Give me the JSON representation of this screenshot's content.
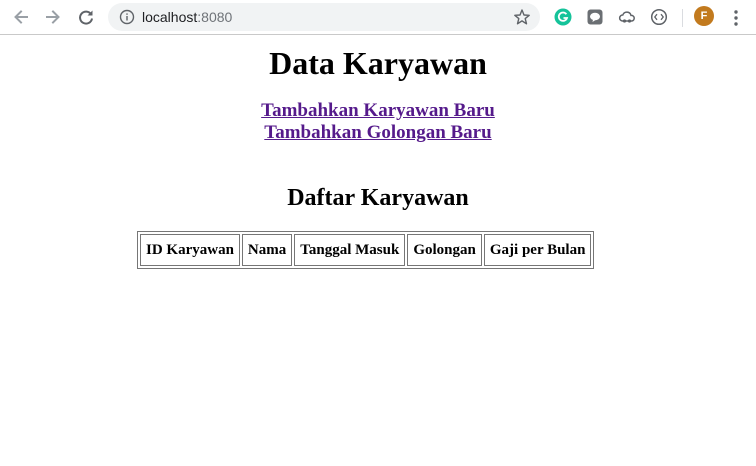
{
  "browser": {
    "url_host": "localhost",
    "url_port": ":8080",
    "profile_initial": "F"
  },
  "page": {
    "title": "Data Karyawan",
    "links": [
      "Tambahkan Karyawan Baru",
      "Tambahkan Golongan Baru"
    ],
    "list_heading": "Daftar Karyawan",
    "table": {
      "headers": [
        "ID Karyawan",
        "Nama",
        "Tanggal Masuk",
        "Golongan",
        "Gaji per Bulan"
      ],
      "rows": []
    }
  },
  "colors": {
    "link_visited": "#551a8b",
    "avatar": "#c27a1e",
    "omnibox_bg": "#f1f3f4"
  },
  "icons": [
    "back-arrow-icon",
    "forward-arrow-icon",
    "reload-icon",
    "info-icon",
    "star-icon",
    "grammarly-icon",
    "line-icon",
    "cloud-icon",
    "code-icon",
    "menu-dots-icon"
  ]
}
